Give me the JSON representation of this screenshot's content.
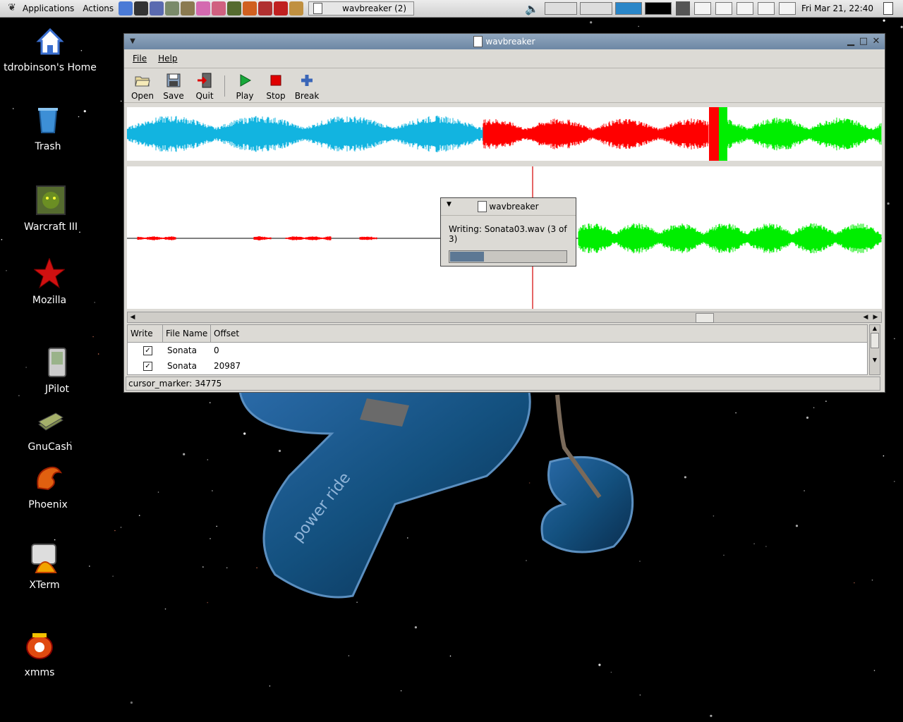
{
  "panel": {
    "menus": [
      "Applications",
      "Actions"
    ],
    "launchers": [
      {
        "icon": "home-launcher-icon",
        "color": "#4a7ad6"
      },
      {
        "icon": "tux-launcher-icon",
        "color": "#333333"
      },
      {
        "icon": "xmms-launcher-icon",
        "color": "#5a6ab0"
      },
      {
        "icon": "jpilot-launcher-icon",
        "color": "#7a8a6a"
      },
      {
        "icon": "gnucash-launcher-icon",
        "color": "#8a7a50"
      },
      {
        "icon": "network-launcher-icon",
        "color": "#d46ab0"
      },
      {
        "icon": "cd-launcher-icon",
        "color": "#d06080"
      },
      {
        "icon": "warcraft-launcher-icon",
        "color": "#556b2f"
      },
      {
        "icon": "phoenix-launcher-icon",
        "color": "#d06020"
      },
      {
        "icon": "game-launcher-icon",
        "color": "#b03030"
      },
      {
        "icon": "mozilla-launcher-icon",
        "color": "#c02020"
      },
      {
        "icon": "compass-launcher-icon",
        "color": "#c09040"
      }
    ],
    "task_label": "wavbreaker (2)",
    "clock": "Fri Mar 21, 22:40"
  },
  "desktop_icons": [
    {
      "label": "tdrobinson's Home",
      "icon": "home-icon"
    },
    {
      "label": "Trash",
      "icon": "trash-icon"
    },
    {
      "label": "Warcraft III",
      "icon": "warcraft-icon"
    },
    {
      "label": "Mozilla",
      "icon": "mozilla-icon"
    },
    {
      "label": "JPilot",
      "icon": "jpilot-icon"
    },
    {
      "label": "GnuCash",
      "icon": "gnucash-icon"
    },
    {
      "label": "Phoenix",
      "icon": "phoenix-icon"
    },
    {
      "label": "XTerm",
      "icon": "xterm-icon"
    },
    {
      "label": "xmms",
      "icon": "xmms-icon"
    }
  ],
  "wallpaper": {
    "text": "power ride"
  },
  "window": {
    "title": "wavbreaker",
    "menu": {
      "file": "File",
      "help": "Help"
    },
    "toolbar": {
      "open": "Open",
      "save": "Save",
      "quit": "Quit",
      "play": "Play",
      "stop": "Stop",
      "break": "Break"
    },
    "colors": {
      "track1": "#12b4e0",
      "track2": "#ff0000",
      "track3": "#00ee00",
      "cursor": "#d40000"
    },
    "list": {
      "headers": [
        "Write",
        "File Name",
        "Offset"
      ],
      "rows": [
        {
          "write": true,
          "file_name": "Sonata",
          "offset": "0"
        },
        {
          "write": true,
          "file_name": "Sonata",
          "offset": "20987"
        }
      ]
    },
    "status": "cursor_marker: 34775"
  },
  "dialog": {
    "title": "wavbreaker",
    "message": "Writing: Sonata03.wav (3 of 3)",
    "progress": 0.29
  }
}
